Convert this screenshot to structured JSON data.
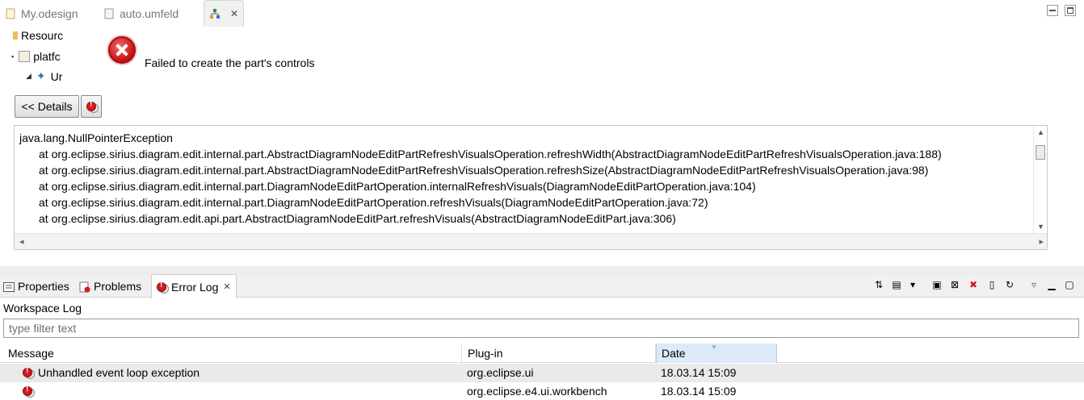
{
  "editor_tabs": [
    {
      "label": "My.odesign",
      "icon": "file-icon"
    },
    {
      "label": "auto.umfeld",
      "icon": "file-icon"
    },
    {
      "label": "",
      "icon": "diagram-icon",
      "active": true
    }
  ],
  "tree": {
    "items": [
      {
        "label": "Resourc"
      },
      {
        "label": "platfc"
      },
      {
        "label": "Ur"
      }
    ]
  },
  "error": {
    "message": "Failed to create the part's controls",
    "details_button": "<< Details"
  },
  "stack_trace": [
    "java.lang.NullPointerException",
    "\tat org.eclipse.sirius.diagram.edit.internal.part.AbstractDiagramNodeEditPartRefreshVisualsOperation.refreshWidth(AbstractDiagramNodeEditPartRefreshVisualsOperation.java:188)",
    "\tat org.eclipse.sirius.diagram.edit.internal.part.AbstractDiagramNodeEditPartRefreshVisualsOperation.refreshSize(AbstractDiagramNodeEditPartRefreshVisualsOperation.java:98)",
    "\tat org.eclipse.sirius.diagram.edit.internal.part.DiagramNodeEditPartOperation.internalRefreshVisuals(DiagramNodeEditPartOperation.java:104)",
    "\tat org.eclipse.sirius.diagram.edit.internal.part.DiagramNodeEditPartOperation.refreshVisuals(DiagramNodeEditPartOperation.java:72)",
    "\tat org.eclipse.sirius.diagram.edit.api.part.AbstractDiagramNodeEditPart.refreshVisuals(AbstractDiagramNodeEditPart.java:306)"
  ],
  "view_tabs": [
    {
      "label": "Properties",
      "icon": "properties-icon"
    },
    {
      "label": "Problems",
      "icon": "problems-icon"
    },
    {
      "label": "Error Log",
      "icon": "error-log-icon",
      "active": true
    }
  ],
  "error_log": {
    "title": "Workspace Log",
    "filter_placeholder": "type filter text",
    "columns": [
      "Message",
      "Plug-in",
      "Date"
    ],
    "rows": [
      {
        "message": "Unhandled event loop exception",
        "plugin": "org.eclipse.ui",
        "date": "18.03.14 15:09"
      },
      {
        "message": "",
        "plugin": "org.eclipse.e4.ui.workbench",
        "date": "18.03.14 15:09"
      }
    ]
  },
  "colors": {
    "error_red": "#d41b1b",
    "date_column_highlight": "#dce9f7"
  }
}
